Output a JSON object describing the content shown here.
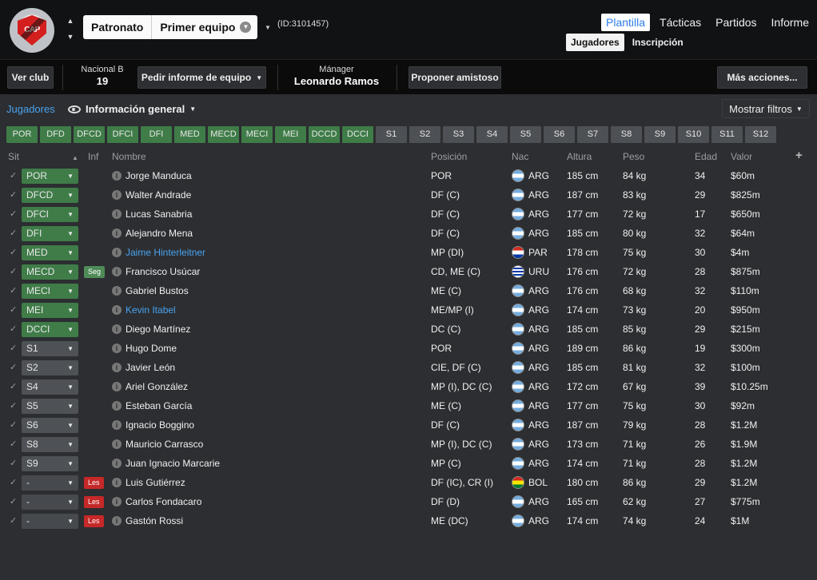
{
  "header": {
    "club_name": "Patronato",
    "squad_name": "Primer equipo",
    "team_id": "(ID:3101457)",
    "nav_tabs": [
      "Plantilla",
      "Tácticas",
      "Partidos",
      "Informe"
    ],
    "active_tab": "Plantilla",
    "sub_tabs": [
      "Jugadores",
      "Inscripción"
    ],
    "active_sub_tab": "Jugadores"
  },
  "toolbar": {
    "view_club": "Ver club",
    "league_label": "Nacional B",
    "league_position": "19",
    "request_report": "Pedir informe de equipo",
    "manager_label": "Mánager",
    "manager_name": "Leonardo Ramos",
    "propose_friendly": "Proponer amistoso",
    "more_actions": "Más acciones..."
  },
  "filters": {
    "breadcrumb": "Jugadores",
    "view_label": "Información general",
    "show_filters": "Mostrar filtros"
  },
  "position_chips": [
    {
      "label": "POR",
      "filled": true
    },
    {
      "label": "DFD",
      "filled": true
    },
    {
      "label": "DFCD",
      "filled": true
    },
    {
      "label": "DFCI",
      "filled": true
    },
    {
      "label": "DFI",
      "filled": true
    },
    {
      "label": "MED",
      "filled": true
    },
    {
      "label": "MECD",
      "filled": true
    },
    {
      "label": "MECI",
      "filled": true
    },
    {
      "label": "MEI",
      "filled": true
    },
    {
      "label": "DCCD",
      "filled": true
    },
    {
      "label": "DCCI",
      "filled": true
    },
    {
      "label": "S1",
      "filled": false
    },
    {
      "label": "S2",
      "filled": false
    },
    {
      "label": "S3",
      "filled": false
    },
    {
      "label": "S4",
      "filled": false
    },
    {
      "label": "S5",
      "filled": false
    },
    {
      "label": "S6",
      "filled": false
    },
    {
      "label": "S7",
      "filled": false
    },
    {
      "label": "S8",
      "filled": false
    },
    {
      "label": "S9",
      "filled": false
    },
    {
      "label": "S10",
      "filled": false
    },
    {
      "label": "S11",
      "filled": false
    },
    {
      "label": "S12",
      "filled": false
    }
  ],
  "columns": {
    "sit": "Sit",
    "inf": "Inf",
    "nombre": "Nombre",
    "posicion": "Posición",
    "nac": "Nac",
    "altura": "Altura",
    "peso": "Peso",
    "edad": "Edad",
    "valor": "Valor"
  },
  "players": [
    {
      "sit": "POR",
      "sit_kind": "g",
      "inf": "",
      "name": "Jorge Manduca",
      "link": false,
      "pos": "POR",
      "flag": "arg",
      "nat": "ARG",
      "height": "185 cm",
      "weight": "84 kg",
      "age": "34",
      "value": "$60m"
    },
    {
      "sit": "DFCD",
      "sit_kind": "g",
      "inf": "",
      "name": "Walter Andrade",
      "link": false,
      "pos": "DF (C)",
      "flag": "arg",
      "nat": "ARG",
      "height": "187 cm",
      "weight": "83 kg",
      "age": "29",
      "value": "$825m"
    },
    {
      "sit": "DFCI",
      "sit_kind": "g",
      "inf": "",
      "name": "Lucas Sanabria",
      "link": false,
      "pos": "DF (C)",
      "flag": "arg",
      "nat": "ARG",
      "height": "177 cm",
      "weight": "72 kg",
      "age": "17",
      "value": "$650m"
    },
    {
      "sit": "DFI",
      "sit_kind": "g",
      "inf": "",
      "name": "Alejandro Mena",
      "link": false,
      "pos": "DF (C)",
      "flag": "arg",
      "nat": "ARG",
      "height": "185 cm",
      "weight": "80 kg",
      "age": "32",
      "value": "$64m"
    },
    {
      "sit": "MED",
      "sit_kind": "g",
      "inf": "",
      "name": "Jaime Hinterleitner",
      "link": true,
      "pos": "MP (DI)",
      "flag": "par",
      "nat": "PAR",
      "height": "178 cm",
      "weight": "75 kg",
      "age": "30",
      "value": "$4m"
    },
    {
      "sit": "MECD",
      "sit_kind": "g",
      "inf": "Seg",
      "name": "Francisco Usúcar",
      "link": false,
      "pos": "CD, ME (C)",
      "flag": "uru",
      "nat": "URU",
      "height": "176 cm",
      "weight": "72 kg",
      "age": "28",
      "value": "$875m"
    },
    {
      "sit": "MECI",
      "sit_kind": "g",
      "inf": "",
      "name": "Gabriel Bustos",
      "link": false,
      "pos": "ME (C)",
      "flag": "arg",
      "nat": "ARG",
      "height": "176 cm",
      "weight": "68 kg",
      "age": "32",
      "value": "$110m"
    },
    {
      "sit": "MEI",
      "sit_kind": "g",
      "inf": "",
      "name": "Kevin Itabel",
      "link": true,
      "pos": "ME/MP (I)",
      "flag": "arg",
      "nat": "ARG",
      "height": "174 cm",
      "weight": "73 kg",
      "age": "20",
      "value": "$950m"
    },
    {
      "sit": "DCCI",
      "sit_kind": "g",
      "inf": "",
      "name": "Diego Martínez",
      "link": false,
      "pos": "DC (C)",
      "flag": "arg",
      "nat": "ARG",
      "height": "185 cm",
      "weight": "85 kg",
      "age": "29",
      "value": "$215m"
    },
    {
      "sit": "S1",
      "sit_kind": "s",
      "inf": "",
      "name": "Hugo Dome",
      "link": false,
      "pos": "POR",
      "flag": "arg",
      "nat": "ARG",
      "height": "189 cm",
      "weight": "86 kg",
      "age": "19",
      "value": "$300m"
    },
    {
      "sit": "S2",
      "sit_kind": "s",
      "inf": "",
      "name": "Javier León",
      "link": false,
      "pos": "CIE, DF (C)",
      "flag": "arg",
      "nat": "ARG",
      "height": "185 cm",
      "weight": "81 kg",
      "age": "32",
      "value": "$100m"
    },
    {
      "sit": "S4",
      "sit_kind": "s",
      "inf": "",
      "name": "Ariel González",
      "link": false,
      "pos": "MP (I), DC (C)",
      "flag": "arg",
      "nat": "ARG",
      "height": "172 cm",
      "weight": "67 kg",
      "age": "39",
      "value": "$10.25m"
    },
    {
      "sit": "S5",
      "sit_kind": "s",
      "inf": "",
      "name": "Esteban García",
      "link": false,
      "pos": "ME (C)",
      "flag": "arg",
      "nat": "ARG",
      "height": "177 cm",
      "weight": "75 kg",
      "age": "30",
      "value": "$92m"
    },
    {
      "sit": "S6",
      "sit_kind": "s",
      "inf": "",
      "name": "Ignacio Boggino",
      "link": false,
      "pos": "DF (C)",
      "flag": "arg",
      "nat": "ARG",
      "height": "187 cm",
      "weight": "79 kg",
      "age": "28",
      "value": "$1.2M"
    },
    {
      "sit": "S8",
      "sit_kind": "s",
      "inf": "",
      "name": "Mauricio Carrasco",
      "link": false,
      "pos": "MP (I), DC (C)",
      "flag": "arg",
      "nat": "ARG",
      "height": "173 cm",
      "weight": "71 kg",
      "age": "26",
      "value": "$1.9M"
    },
    {
      "sit": "S9",
      "sit_kind": "s",
      "inf": "",
      "name": "Juan Ignacio Marcarie",
      "link": false,
      "pos": "MP (C)",
      "flag": "arg",
      "nat": "ARG",
      "height": "174 cm",
      "weight": "71 kg",
      "age": "28",
      "value": "$1.2M"
    },
    {
      "sit": "-",
      "sit_kind": "n",
      "inf": "Les",
      "name": "Luis Gutiérrez",
      "link": false,
      "pos": "DF (IC), CR (I)",
      "flag": "bol",
      "nat": "BOL",
      "height": "180 cm",
      "weight": "86 kg",
      "age": "29",
      "value": "$1.2M"
    },
    {
      "sit": "-",
      "sit_kind": "n",
      "inf": "Les",
      "name": "Carlos Fondacaro",
      "link": false,
      "pos": "DF (D)",
      "flag": "arg",
      "nat": "ARG",
      "height": "165 cm",
      "weight": "62 kg",
      "age": "27",
      "value": "$775m"
    },
    {
      "sit": "-",
      "sit_kind": "n",
      "inf": "Les",
      "name": "Gastón Rossi",
      "link": false,
      "pos": "ME (DC)",
      "flag": "arg",
      "nat": "ARG",
      "height": "174 cm",
      "weight": "74 kg",
      "age": "24",
      "value": "$1M"
    }
  ]
}
